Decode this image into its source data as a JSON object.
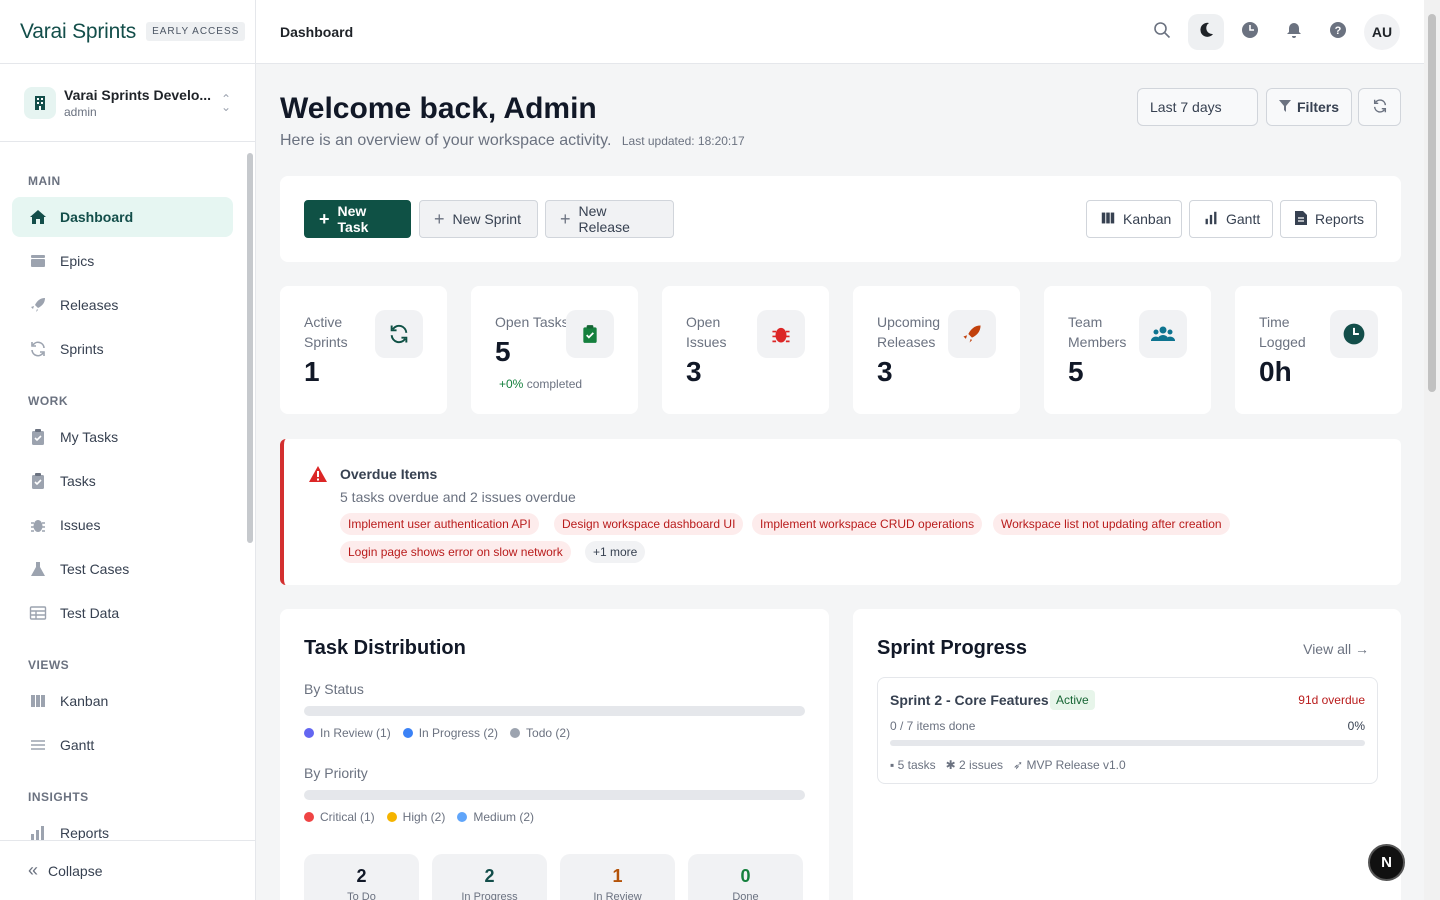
{
  "brand": {
    "name": "Varai Sprints",
    "badge": "EARLY ACCESS"
  },
  "workspace": {
    "name": "Varai Sprints Develo...",
    "role": "admin"
  },
  "nav": {
    "sections": [
      "MAIN",
      "WORK",
      "VIEWS",
      "INSIGHTS"
    ],
    "items": [
      {
        "label": "Dashboard",
        "icon": "home-icon"
      },
      {
        "label": "Epics",
        "icon": "layers-icon"
      },
      {
        "label": "Releases",
        "icon": "rocket-icon"
      },
      {
        "label": "Sprints",
        "icon": "refresh-icon"
      },
      {
        "label": "My Tasks",
        "icon": "clipboard-check-icon"
      },
      {
        "label": "Tasks",
        "icon": "clipboard-check-icon"
      },
      {
        "label": "Issues",
        "icon": "bug-icon"
      },
      {
        "label": "Test Cases",
        "icon": "flask-icon"
      },
      {
        "label": "Test Data",
        "icon": "table-icon"
      },
      {
        "label": "Kanban",
        "icon": "columns-icon"
      },
      {
        "label": "Gantt",
        "icon": "gantt-icon"
      },
      {
        "label": "Reports",
        "icon": "bar-chart-icon"
      }
    ],
    "collapse": "Collapse"
  },
  "topbar": {
    "breadcrumb": "Dashboard",
    "avatar": "AU"
  },
  "header": {
    "title": "Welcome back, Admin",
    "subtitle": "Here is an overview of your workspace activity.",
    "updated": "Last updated: 18:20:17",
    "range": "Last 7 days",
    "filters": "Filters"
  },
  "actions": {
    "new_task": "New Task",
    "new_sprint": "New Sprint",
    "new_release": "New Release",
    "kanban": "Kanban",
    "gantt": "Gantt",
    "reports": "Reports"
  },
  "stats": [
    {
      "label": "Active Sprints",
      "value": "1",
      "icon": "refresh-icon",
      "color": "#0f5145"
    },
    {
      "label": "Open Tasks",
      "value": "5",
      "note_pct": "+0%",
      "note": "completed",
      "icon": "clipboard-check-icon",
      "color": "#15803d"
    },
    {
      "label": "Open Issues",
      "value": "3",
      "icon": "bug-icon",
      "color": "#dc2626"
    },
    {
      "label": "Upcoming Releases",
      "value": "3",
      "icon": "rocket-icon",
      "color": "#c2410c"
    },
    {
      "label": "Team Members",
      "value": "5",
      "icon": "users-icon",
      "color": "#0e7490"
    },
    {
      "label": "Time Logged",
      "value": "0h",
      "icon": "clock-icon",
      "color": "#134e4a"
    }
  ],
  "overdue": {
    "title": "Overdue Items",
    "summary": "5 tasks overdue and 2 issues overdue",
    "items": [
      "Implement user authentication API",
      "Design workspace dashboard UI",
      "Implement workspace CRUD operations",
      "Workspace list not updating after creation",
      "Login page shows error on slow network"
    ],
    "more": "+1 more"
  },
  "distribution": {
    "title": "Task Distribution",
    "by_status": "By Status",
    "by_priority": "By Priority",
    "status_legend": [
      {
        "label": "In Review (1)",
        "color": "#6366f1"
      },
      {
        "label": "In Progress (2)",
        "color": "#3b82f6"
      },
      {
        "label": "Todo (2)",
        "color": "#9ca3af"
      }
    ],
    "priority_legend": [
      {
        "label": "Critical (1)",
        "color": "#ef4444"
      },
      {
        "label": "High (2)",
        "color": "#f5b400"
      },
      {
        "label": "Medium (2)",
        "color": "#60a5fa"
      }
    ],
    "counts": [
      {
        "n": "2",
        "label": "To Do",
        "color": "#111827"
      },
      {
        "n": "2",
        "label": "In Progress",
        "color": "#134e4a"
      },
      {
        "n": "1",
        "label": "In Review",
        "color": "#b45309"
      },
      {
        "n": "0",
        "label": "Done",
        "color": "#15803d"
      }
    ]
  },
  "sprint": {
    "title": "Sprint Progress",
    "view_all": "View all",
    "name": "Sprint 2 - Core Features",
    "status": "Active",
    "overdue": "91d overdue",
    "items_done": "0 / 7 items done",
    "pct": "0%",
    "tasks": "5 tasks",
    "issues": "2 issues",
    "release": "MVP Release v1.0"
  },
  "fab": "N"
}
